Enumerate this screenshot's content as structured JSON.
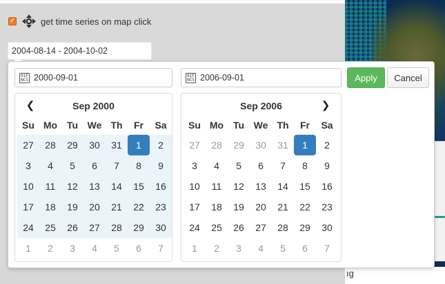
{
  "timeseries": {
    "label": "get time series on map click",
    "checked": true
  },
  "range_input": {
    "value": "2004-08-14 - 2004-10-02"
  },
  "picker": {
    "start_field": "2000-09-01",
    "end_field": "2006-09-01",
    "field_icon_text": "0 1 F\nN C S",
    "apply_label": "Apply",
    "cancel_label": "Cancel",
    "colors": {
      "apply": "#5cb85c",
      "active": "#357ebd",
      "in_range": "#ebf4f8"
    }
  },
  "map": {
    "tail_text": "ıg"
  },
  "weekdays": [
    "Su",
    "Mo",
    "Tu",
    "We",
    "Th",
    "Fr",
    "Sa"
  ],
  "calendars": [
    {
      "title": "Sep 2000",
      "prev": "❮",
      "next": "❯",
      "weeks": [
        [
          {
            "d": "27",
            "s": "off in"
          },
          {
            "d": "28",
            "s": "off in"
          },
          {
            "d": "29",
            "s": "off in"
          },
          {
            "d": "30",
            "s": "off in"
          },
          {
            "d": "31",
            "s": "off in"
          },
          {
            "d": "1",
            "s": "active"
          },
          {
            "d": "2",
            "s": "in"
          }
        ],
        [
          {
            "d": "3",
            "s": "in"
          },
          {
            "d": "4",
            "s": "in"
          },
          {
            "d": "5",
            "s": "in"
          },
          {
            "d": "6",
            "s": "in"
          },
          {
            "d": "7",
            "s": "in"
          },
          {
            "d": "8",
            "s": "in"
          },
          {
            "d": "9",
            "s": "in"
          }
        ],
        [
          {
            "d": "10",
            "s": "in"
          },
          {
            "d": "11",
            "s": "in"
          },
          {
            "d": "12",
            "s": "in"
          },
          {
            "d": "13",
            "s": "in"
          },
          {
            "d": "14",
            "s": "in"
          },
          {
            "d": "15",
            "s": "in"
          },
          {
            "d": "16",
            "s": "in"
          }
        ],
        [
          {
            "d": "17",
            "s": "in"
          },
          {
            "d": "18",
            "s": "in"
          },
          {
            "d": "19",
            "s": "in"
          },
          {
            "d": "20",
            "s": "in"
          },
          {
            "d": "21",
            "s": "in"
          },
          {
            "d": "22",
            "s": "in"
          },
          {
            "d": "23",
            "s": "in"
          }
        ],
        [
          {
            "d": "24",
            "s": "in"
          },
          {
            "d": "25",
            "s": "in"
          },
          {
            "d": "26",
            "s": "in"
          },
          {
            "d": "27",
            "s": "in"
          },
          {
            "d": "28",
            "s": "in"
          },
          {
            "d": "29",
            "s": "in"
          },
          {
            "d": "30",
            "s": "in"
          }
        ],
        [
          {
            "d": "1",
            "s": "off"
          },
          {
            "d": "2",
            "s": "off"
          },
          {
            "d": "3",
            "s": "off"
          },
          {
            "d": "4",
            "s": "off"
          },
          {
            "d": "5",
            "s": "off"
          },
          {
            "d": "6",
            "s": "off"
          },
          {
            "d": "7",
            "s": "off"
          }
        ]
      ]
    },
    {
      "title": "Sep 2006",
      "prev": "❮",
      "next": "❯",
      "weeks": [
        [
          {
            "d": "27",
            "s": "off"
          },
          {
            "d": "28",
            "s": "off"
          },
          {
            "d": "29",
            "s": "off"
          },
          {
            "d": "30",
            "s": "off"
          },
          {
            "d": "31",
            "s": "off"
          },
          {
            "d": "1",
            "s": "active"
          },
          {
            "d": "2",
            "s": "normal"
          }
        ],
        [
          {
            "d": "3",
            "s": "normal"
          },
          {
            "d": "4",
            "s": "normal"
          },
          {
            "d": "5",
            "s": "normal"
          },
          {
            "d": "6",
            "s": "normal"
          },
          {
            "d": "7",
            "s": "normal"
          },
          {
            "d": "8",
            "s": "normal"
          },
          {
            "d": "9",
            "s": "normal"
          }
        ],
        [
          {
            "d": "10",
            "s": "normal"
          },
          {
            "d": "11",
            "s": "normal"
          },
          {
            "d": "12",
            "s": "normal"
          },
          {
            "d": "13",
            "s": "normal"
          },
          {
            "d": "14",
            "s": "normal"
          },
          {
            "d": "15",
            "s": "normal"
          },
          {
            "d": "16",
            "s": "normal"
          }
        ],
        [
          {
            "d": "17",
            "s": "normal"
          },
          {
            "d": "18",
            "s": "normal"
          },
          {
            "d": "19",
            "s": "normal"
          },
          {
            "d": "20",
            "s": "normal"
          },
          {
            "d": "21",
            "s": "normal"
          },
          {
            "d": "22",
            "s": "normal"
          },
          {
            "d": "23",
            "s": "normal"
          }
        ],
        [
          {
            "d": "24",
            "s": "normal"
          },
          {
            "d": "25",
            "s": "normal"
          },
          {
            "d": "26",
            "s": "normal"
          },
          {
            "d": "27",
            "s": "normal"
          },
          {
            "d": "28",
            "s": "normal"
          },
          {
            "d": "29",
            "s": "normal"
          },
          {
            "d": "30",
            "s": "normal"
          }
        ],
        [
          {
            "d": "1",
            "s": "off"
          },
          {
            "d": "2",
            "s": "off"
          },
          {
            "d": "3",
            "s": "off"
          },
          {
            "d": "4",
            "s": "off"
          },
          {
            "d": "5",
            "s": "off"
          },
          {
            "d": "6",
            "s": "off"
          },
          {
            "d": "7",
            "s": "off"
          }
        ]
      ]
    }
  ]
}
